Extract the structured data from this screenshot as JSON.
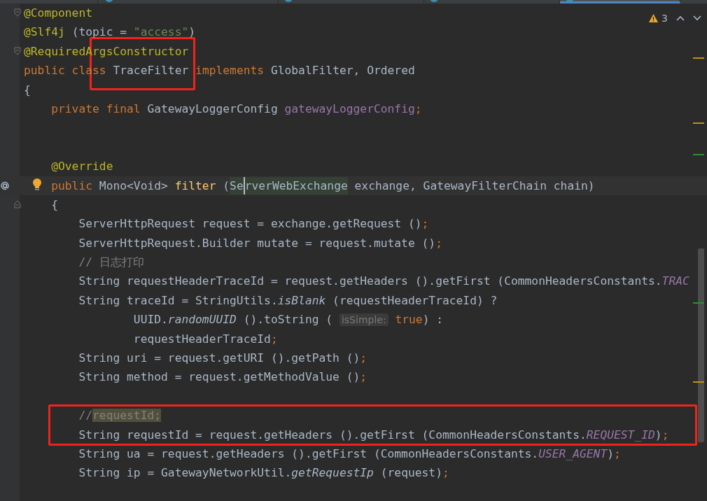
{
  "tabs": [
    {
      "selected": false
    },
    {
      "selected": false
    },
    {
      "selected": false
    },
    {
      "selected": false
    },
    {
      "selected": true
    }
  ],
  "inspections": {
    "warning_count": "3"
  },
  "code_lines": [
    {
      "kind": "code",
      "markers": [
        {
          "kind": "fold"
        }
      ],
      "tokens": [
        {
          "kind": "ann",
          "t": "@Component"
        }
      ]
    },
    {
      "kind": "code",
      "tokens": [
        {
          "kind": "ann",
          "t": "@Slf4j"
        },
        {
          "kind": "plain",
          "t": " (topic = "
        },
        {
          "kind": "str",
          "t": "\"access\""
        },
        {
          "kind": "plain",
          "t": ")"
        }
      ]
    },
    {
      "kind": "code",
      "markers": [
        {
          "kind": "fold"
        }
      ],
      "tokens": [
        {
          "kind": "ann",
          "t": "@RequiredArgsConstructor"
        }
      ]
    },
    {
      "kind": "code",
      "tokens": [
        {
          "kind": "kw",
          "t": "public class "
        },
        {
          "kind": "plain",
          "t": "TraceFilter "
        },
        {
          "kind": "kw",
          "t": "implements "
        },
        {
          "kind": "plain",
          "t": "GlobalFilter, Ordered"
        }
      ]
    },
    {
      "kind": "code",
      "tokens": [
        {
          "kind": "plain",
          "t": "{"
        }
      ]
    },
    {
      "kind": "code",
      "tokens": [
        {
          "kind": "kw",
          "t": "    private final "
        },
        {
          "kind": "plain",
          "t": "GatewayLoggerConfig "
        },
        {
          "kind": "field",
          "t": "gatewayLoggerConfig"
        },
        {
          "kind": "kw",
          "t": ";"
        }
      ]
    },
    {
      "kind": "blank"
    },
    {
      "kind": "blank"
    },
    {
      "kind": "code",
      "tokens": [
        {
          "kind": "ann",
          "t": "    @Override"
        }
      ]
    },
    {
      "kind": "code",
      "current": true,
      "markers": [
        {
          "kind": "override"
        },
        {
          "kind": "bulb"
        }
      ],
      "tokens": [
        {
          "kind": "kw",
          "t": "    public "
        },
        {
          "kind": "plain",
          "t": "Mono<Void> "
        },
        {
          "kind": "fn",
          "t": "filter"
        },
        {
          "kind": "plain",
          "t": " ("
        },
        {
          "kind": "match",
          "t": "Se"
        },
        {
          "kind": "match",
          "t": "rverWebExchange",
          "caret": true
        },
        {
          "kind": "plain",
          "t": " exchange, GatewayFilterChain chain)"
        }
      ]
    },
    {
      "kind": "code",
      "markers": [
        {
          "kind": "fold-end"
        }
      ],
      "tokens": [
        {
          "kind": "plain",
          "t": "    {"
        }
      ]
    },
    {
      "kind": "code",
      "tokens": [
        {
          "kind": "plain",
          "t": "        ServerHttpRequest request = exchange.getRequest ()"
        },
        {
          "kind": "kw",
          "t": ";"
        }
      ]
    },
    {
      "kind": "code",
      "tokens": [
        {
          "kind": "plain",
          "t": "        ServerHttpRequest.Builder mutate = request.mutate ()"
        },
        {
          "kind": "kw",
          "t": ";"
        }
      ]
    },
    {
      "kind": "code",
      "tokens": [
        {
          "kind": "comment",
          "t": "        // 日志打印"
        }
      ]
    },
    {
      "kind": "code",
      "tokens": [
        {
          "kind": "plain",
          "t": "        String requestHeaderTraceId = request.getHeaders ().getFirst (CommonHeadersConstants."
        },
        {
          "kind": "static",
          "t": "TRAC"
        }
      ]
    },
    {
      "kind": "code",
      "tokens": [
        {
          "kind": "plain",
          "t": "        String traceId = StringUtils."
        },
        {
          "kind": "italic",
          "t": "isBlank"
        },
        {
          "kind": "plain",
          "t": " (requestHeaderTraceId) ?"
        }
      ]
    },
    {
      "kind": "code",
      "tokens": [
        {
          "kind": "plain",
          "t": "                UUID."
        },
        {
          "kind": "italic",
          "t": "randomUUID"
        },
        {
          "kind": "plain",
          "t": " ().toString ( "
        },
        {
          "kind": "hint",
          "t": "isSimple:"
        },
        {
          "kind": "kw",
          "t": " true"
        },
        {
          "kind": "plain",
          "t": ") :"
        }
      ]
    },
    {
      "kind": "code",
      "tokens": [
        {
          "kind": "plain",
          "t": "                requestHeaderTraceId"
        },
        {
          "kind": "kw",
          "t": ";"
        }
      ]
    },
    {
      "kind": "code",
      "tokens": [
        {
          "kind": "plain",
          "t": "        String uri = request.getURI ().getPath ()"
        },
        {
          "kind": "kw",
          "t": ";"
        }
      ]
    },
    {
      "kind": "code",
      "tokens": [
        {
          "kind": "plain",
          "t": "        String method = request.getMethodValue ()"
        },
        {
          "kind": "kw",
          "t": ";"
        }
      ]
    },
    {
      "kind": "blank"
    },
    {
      "kind": "code",
      "tokens": [
        {
          "kind": "comment",
          "t": "        //"
        },
        {
          "kind": "found",
          "t": "requestId;"
        }
      ]
    },
    {
      "kind": "code",
      "tokens": [
        {
          "kind": "plain",
          "t": "        String requestId = request.getHeaders ().getFirst (CommonHeadersConstants."
        },
        {
          "kind": "static",
          "t": "REQUEST_ID"
        },
        {
          "kind": "plain",
          "t": ")"
        },
        {
          "kind": "kw",
          "t": ";"
        }
      ]
    },
    {
      "kind": "code",
      "tokens": [
        {
          "kind": "plain",
          "t": "        String ua = request.getHeaders ().getFirst (CommonHeadersConstants."
        },
        {
          "kind": "static",
          "t": "USER_AGENT"
        },
        {
          "kind": "plain",
          "t": ")"
        },
        {
          "kind": "kw",
          "t": ";"
        }
      ]
    },
    {
      "kind": "code",
      "tokens": [
        {
          "kind": "plain",
          "t": "        String ip = GatewayNetworkUtil."
        },
        {
          "kind": "italic",
          "t": "getRequestIp"
        },
        {
          "kind": "plain",
          "t": " (request)"
        },
        {
          "kind": "kw",
          "t": ";"
        }
      ]
    },
    {
      "kind": "blank"
    }
  ],
  "highlight_frames": [
    {
      "kind": "box"
    },
    {
      "kind": "box"
    }
  ],
  "scroll_marks": [
    {
      "color": "#be9117"
    },
    {
      "color": "#be9117"
    },
    {
      "color": "#2f8c2f"
    },
    {
      "color": "#2f8c2f"
    },
    {
      "color": "#be9117"
    }
  ]
}
